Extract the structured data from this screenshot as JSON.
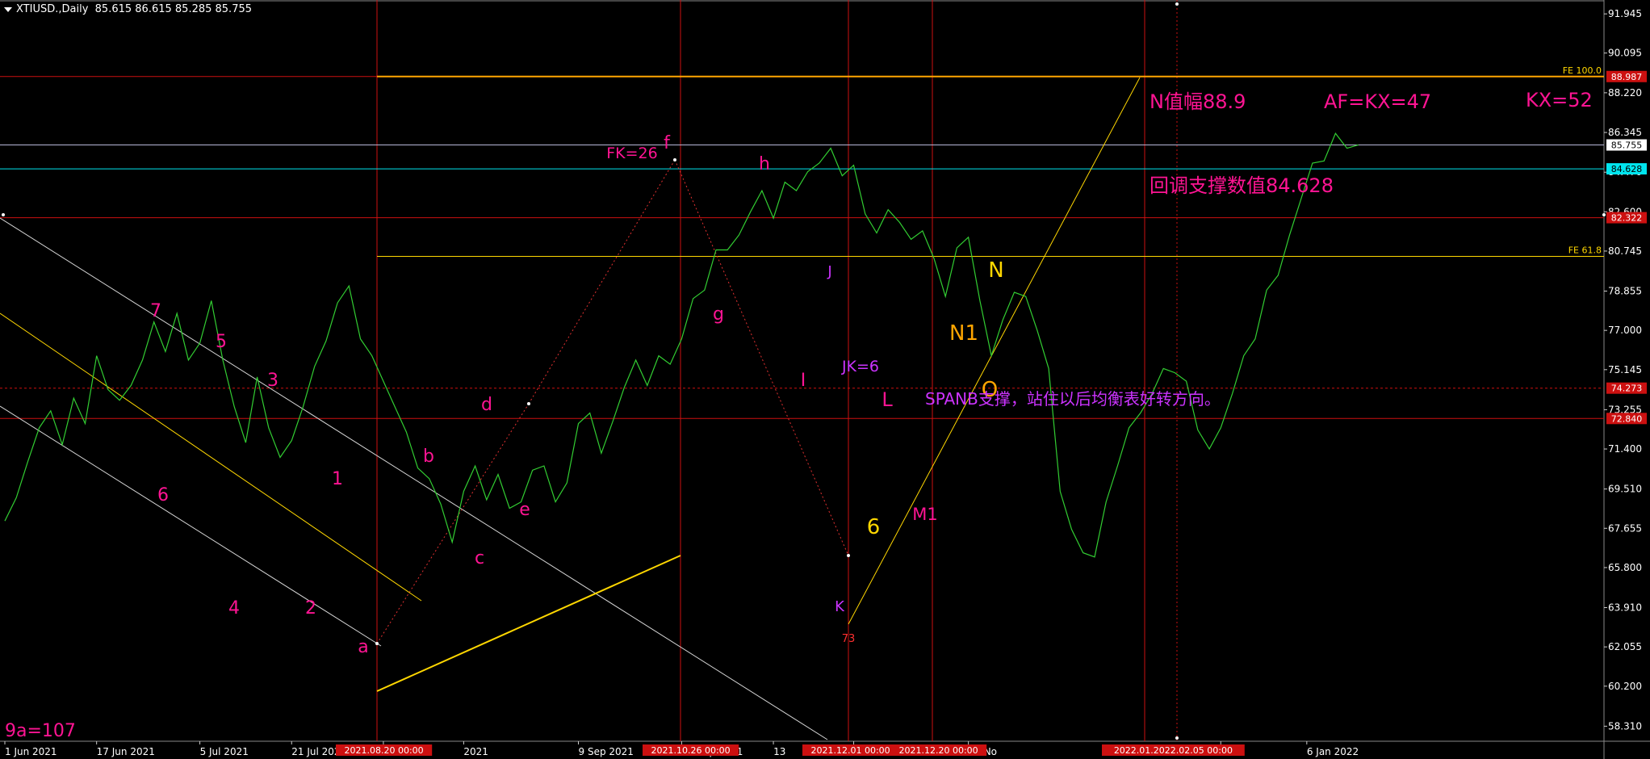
{
  "header": {
    "symbol": "XTIUSD.,Daily",
    "ohlc": "85.615 86.615 85.285 85.755"
  },
  "colors": {
    "bg": "#000000",
    "price": "#32cd32",
    "grid": "#c8c8c8",
    "red": "#cc1010",
    "magenta": "#ff1493",
    "violet": "#cc33ff",
    "gold": "#ffd700",
    "orange": "#ffa500",
    "cyan": "#00e5ee"
  },
  "chart_data": {
    "type": "line",
    "title": "XTIUSD.,Daily",
    "ylim": [
      57.6,
      92.6
    ],
    "y_ticks": [
      "91.945",
      "90.095",
      "88.220",
      "86.345",
      "84.470",
      "82.600",
      "80.745",
      "78.855",
      "77.000",
      "75.145",
      "73.255",
      "71.400",
      "69.510",
      "67.655",
      "65.800",
      "63.910",
      "62.055",
      "60.200",
      "58.310"
    ],
    "x_ticks": [
      "1 Jun 2021",
      "17 Jun 2021",
      "5 Jul 2021",
      "21 Jul 2021",
      "6 Au",
      "2021",
      "9 Sep 2021",
      "27 Sep 2021",
      "13",
      "t 2021",
      "16 No",
      "21",
      "6 Jan 2022"
    ],
    "x_tick_days": [
      0,
      16,
      34,
      50,
      66,
      80,
      100,
      118,
      134,
      148,
      168,
      212,
      227
    ],
    "series": [
      {
        "values": [
          [
            0,
            68.0
          ],
          [
            2,
            69.1
          ],
          [
            4,
            70.8
          ],
          [
            6,
            72.4
          ],
          [
            8,
            73.2
          ],
          [
            10,
            71.6
          ],
          [
            12,
            73.8
          ],
          [
            14,
            72.6
          ],
          [
            16,
            75.8
          ],
          [
            18,
            74.2
          ],
          [
            20,
            73.7
          ],
          [
            22,
            74.4
          ],
          [
            24,
            75.6
          ],
          [
            26,
            77.4
          ],
          [
            28,
            76.0
          ],
          [
            30,
            77.8
          ],
          [
            32,
            75.6
          ],
          [
            34,
            76.4
          ],
          [
            36,
            78.4
          ],
          [
            38,
            75.6
          ],
          [
            40,
            73.4
          ],
          [
            42,
            71.7
          ],
          [
            44,
            74.8
          ],
          [
            46,
            72.4
          ],
          [
            48,
            71.0
          ],
          [
            50,
            71.8
          ],
          [
            52,
            73.4
          ],
          [
            54,
            75.3
          ],
          [
            56,
            76.5
          ],
          [
            58,
            78.3
          ],
          [
            60,
            79.1
          ],
          [
            62,
            76.6
          ],
          [
            64,
            75.8
          ],
          [
            66,
            74.6
          ],
          [
            68,
            73.4
          ],
          [
            70,
            72.2
          ],
          [
            72,
            70.5
          ],
          [
            74,
            70.0
          ],
          [
            76,
            68.8
          ],
          [
            78,
            67.0
          ],
          [
            80,
            69.4
          ],
          [
            82,
            70.6
          ],
          [
            84,
            69.0
          ],
          [
            86,
            70.2
          ],
          [
            88,
            68.6
          ],
          [
            90,
            68.9
          ],
          [
            92,
            70.4
          ],
          [
            94,
            70.6
          ],
          [
            96,
            68.9
          ],
          [
            98,
            69.8
          ],
          [
            100,
            72.6
          ],
          [
            102,
            73.1
          ],
          [
            104,
            71.2
          ],
          [
            106,
            72.7
          ],
          [
            108,
            74.3
          ],
          [
            110,
            75.6
          ],
          [
            112,
            74.4
          ],
          [
            114,
            75.8
          ],
          [
            116,
            75.4
          ],
          [
            118,
            76.6
          ],
          [
            120,
            78.5
          ],
          [
            122,
            78.9
          ],
          [
            124,
            80.8
          ],
          [
            126,
            80.8
          ],
          [
            128,
            81.5
          ],
          [
            130,
            82.6
          ],
          [
            132,
            83.6
          ],
          [
            134,
            82.3
          ],
          [
            136,
            84.0
          ],
          [
            138,
            83.6
          ],
          [
            140,
            84.5
          ],
          [
            142,
            84.9
          ],
          [
            144,
            85.6
          ],
          [
            146,
            84.3
          ],
          [
            148,
            84.8
          ],
          [
            150,
            82.5
          ],
          [
            152,
            81.6
          ],
          [
            154,
            82.7
          ],
          [
            156,
            82.1
          ],
          [
            158,
            81.3
          ],
          [
            160,
            81.7
          ],
          [
            162,
            80.4
          ],
          [
            164,
            78.6
          ],
          [
            166,
            80.9
          ],
          [
            168,
            81.4
          ],
          [
            170,
            78.4
          ],
          [
            172,
            75.8
          ],
          [
            174,
            77.5
          ],
          [
            176,
            78.8
          ],
          [
            178,
            78.6
          ],
          [
            180,
            77.0
          ],
          [
            182,
            75.2
          ],
          [
            184,
            69.4
          ],
          [
            186,
            67.6
          ],
          [
            188,
            66.5
          ],
          [
            190,
            66.3
          ],
          [
            192,
            68.9
          ],
          [
            194,
            70.6
          ],
          [
            196,
            72.4
          ],
          [
            198,
            73.1
          ],
          [
            200,
            74.0
          ],
          [
            202,
            75.2
          ],
          [
            204,
            75.0
          ],
          [
            206,
            74.6
          ],
          [
            208,
            72.3
          ],
          [
            210,
            71.4
          ],
          [
            212,
            72.4
          ],
          [
            214,
            74.0
          ],
          [
            216,
            75.8
          ],
          [
            218,
            76.6
          ],
          [
            220,
            78.9
          ],
          [
            222,
            79.6
          ],
          [
            224,
            81.5
          ],
          [
            226,
            83.2
          ],
          [
            228,
            84.9
          ],
          [
            230,
            85.0
          ],
          [
            232,
            86.3
          ],
          [
            234,
            85.6
          ],
          [
            236,
            85.76
          ]
        ]
      }
    ]
  },
  "price_labels": [
    {
      "text": "88.987",
      "value": 88.987,
      "bg": "#cc1010"
    },
    {
      "text": "85.755",
      "value": 85.755,
      "bg": "#ffffff"
    },
    {
      "text": "84.628",
      "value": 84.628,
      "bg": "#00e5ee"
    },
    {
      "text": "82.322",
      "value": 82.322,
      "bg": "#cc1010"
    },
    {
      "text": "74.273",
      "value": 74.273,
      "bg": "#cc1010"
    },
    {
      "text": "72.840",
      "value": 72.84,
      "bg": "#cc1010"
    }
  ],
  "fe_labels": [
    {
      "text": "FE 100.0",
      "value": 88.987
    },
    {
      "text": "FE 61.8",
      "value": 80.495
    }
  ],
  "date_labels": [
    "2021.08.20 00:00",
    "2021.10.26 00:00",
    "2021.12.01 00:00",
    "2021.12.20 00:00",
    "2022.01.2022.02.05 00:00"
  ],
  "wave_labels": [
    {
      "text": "7",
      "color": "#ff1493",
      "size": 22
    },
    {
      "text": "5",
      "color": "#ff1493",
      "size": 22
    },
    {
      "text": "3",
      "color": "#ff1493",
      "size": 22
    },
    {
      "text": "1",
      "color": "#ff1493",
      "size": 22
    },
    {
      "text": "6",
      "color": "#ff1493",
      "size": 22
    },
    {
      "text": "4",
      "color": "#ff1493",
      "size": 22
    },
    {
      "text": "2",
      "color": "#ff1493",
      "size": 22
    },
    {
      "text": "a",
      "color": "#ff1493",
      "size": 22
    },
    {
      "text": "b",
      "color": "#ff1493",
      "size": 22
    },
    {
      "text": "c",
      "color": "#ff1493",
      "size": 22
    },
    {
      "text": "d",
      "color": "#ff1493",
      "size": 22
    },
    {
      "text": "e",
      "color": "#ff1493",
      "size": 22
    },
    {
      "text": "f",
      "color": "#ff1493",
      "size": 22
    },
    {
      "text": "g",
      "color": "#ff1493",
      "size": 22
    },
    {
      "text": "h",
      "color": "#ff1493",
      "size": 22
    },
    {
      "text": "I",
      "color": "#ff1493",
      "size": 22
    },
    {
      "text": "J",
      "color": "#cc33ff",
      "size": 18
    },
    {
      "text": "K",
      "color": "#cc33ff",
      "size": 18
    },
    {
      "text": "L",
      "color": "#ff1493",
      "size": 24
    },
    {
      "text": "M1",
      "color": "#ff1493",
      "size": 21
    },
    {
      "text": "N1",
      "color": "#ffa500",
      "size": 26
    },
    {
      "text": "N",
      "color": "#ffd700",
      "size": 26
    },
    {
      "text": "O",
      "color": "#ffa500",
      "size": 26
    },
    {
      "text": "6",
      "color": "#ffd700",
      "size": 26
    },
    {
      "text": "73",
      "color": "#ff3030",
      "size": 13
    },
    {
      "text": "FK=26",
      "color": "#ff1493",
      "size": 19
    },
    {
      "text": "JK=6",
      "color": "#cc33ff",
      "size": 19
    }
  ],
  "annotations": [
    {
      "text": "N值幅88.9",
      "color": "#ff1493",
      "size": 24
    },
    {
      "text": "AF=KX=47",
      "color": "#ff1493",
      "size": 24
    },
    {
      "text": "KX=52",
      "color": "#ff1493",
      "size": 24
    },
    {
      "text": "回调支撑数值84.628",
      "color": "#ff1493",
      "size": 24
    },
    {
      "text": "SPANB支撑，站住以后均衡表好转方向。",
      "color": "#cc33ff",
      "size": 20
    },
    {
      "text": "9a=107",
      "color": "#ff1493",
      "size": 22
    }
  ]
}
